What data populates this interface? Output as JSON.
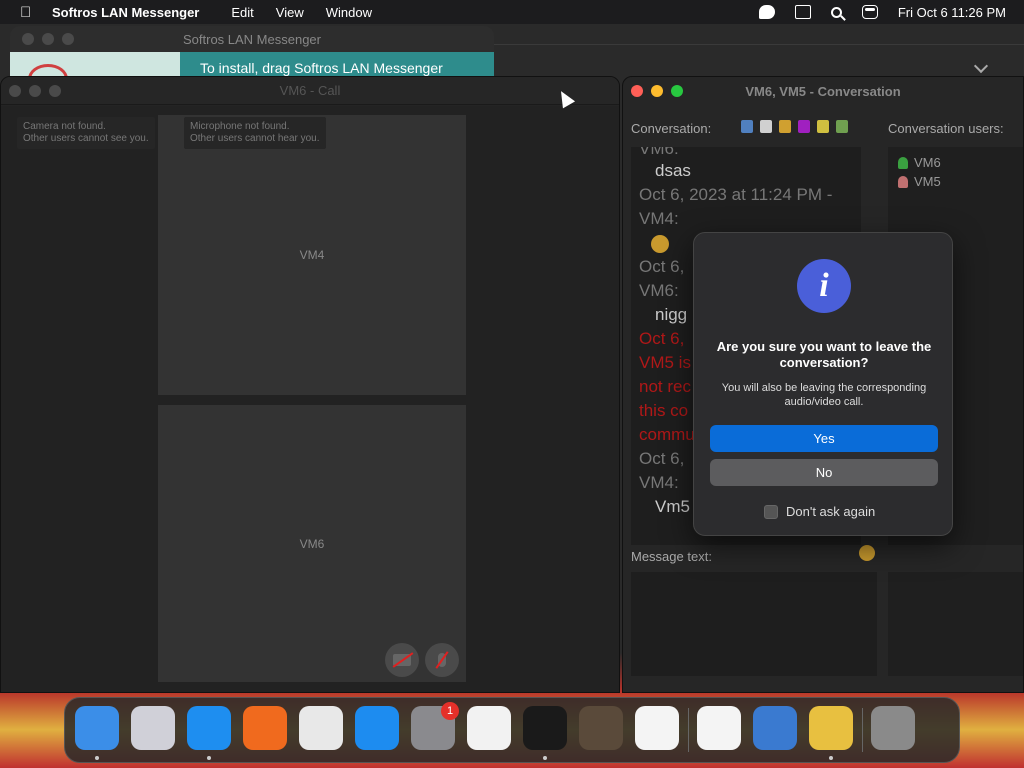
{
  "menubar": {
    "app_name": "Softros LAN Messenger",
    "menus": [
      "Edit",
      "View",
      "Window"
    ],
    "datetime": "Fri Oct 6  11:26 PM"
  },
  "installer": {
    "title": "Softros LAN Messenger",
    "banner": "To install, drag Softros LAN Messenger"
  },
  "call_window": {
    "title": "VM6 - Call",
    "camera_notice_1": "Camera not found.",
    "camera_notice_2": "Other users cannot see you.",
    "mic_notice_1": "Microphone not found.",
    "mic_notice_2": "Other users cannot hear you.",
    "tiles": [
      "VM4",
      "VM6"
    ]
  },
  "conversation_window": {
    "title": "VM6, VM5 - Conversation",
    "conversation_label": "Conversation:",
    "users_label": "Conversation users:",
    "message_label": "Message text:",
    "chat_lines": [
      {
        "text": "VM6:",
        "kind": "meta"
      },
      {
        "text": "dsas",
        "kind": "msg"
      },
      {
        "text": "Oct 6, 2023 at 11:24 PM -",
        "kind": "meta"
      },
      {
        "text": "VM4:",
        "kind": "meta"
      },
      {
        "text": "Oct 6,",
        "kind": "meta"
      },
      {
        "text": "VM6:",
        "kind": "meta"
      },
      {
        "text": "nigg",
        "kind": "msg"
      },
      {
        "text": "Oct 6,",
        "kind": "red"
      },
      {
        "text": "VM5 is",
        "kind": "red"
      },
      {
        "text": "not rec",
        "kind": "red"
      },
      {
        "text": "this co",
        "kind": "red"
      },
      {
        "text": "commu",
        "kind": "red"
      },
      {
        "text": "Oct 6,",
        "kind": "meta"
      },
      {
        "text": "VM4:",
        "kind": "meta"
      },
      {
        "text": "Vm5",
        "kind": "msg"
      }
    ],
    "users": [
      "VM6",
      "VM5"
    ],
    "user_colors": [
      "#3aa040",
      "#c07070"
    ],
    "toolbar_colors": [
      "#5080c0",
      "#d0d0d0",
      "#d0a030",
      "#a020c0",
      "#d0c040",
      "#70a050"
    ]
  },
  "dialog": {
    "title": "Are you sure you want to leave the conversation?",
    "description": "You will also be leaving the corresponding audio/video call.",
    "yes_label": "Yes",
    "no_label": "No",
    "checkbox_label": "Don't ask again",
    "icon": "info-icon"
  },
  "dock": {
    "apps": [
      {
        "name": "finder-icon",
        "color": "#3b8ee8",
        "running": true
      },
      {
        "name": "launchpad-icon",
        "color": "#d0d0d8",
        "running": false
      },
      {
        "name": "safari-icon",
        "color": "#1e8ef0",
        "running": true
      },
      {
        "name": "firefox-icon",
        "color": "#f06a1e",
        "running": false
      },
      {
        "name": "chrome-icon",
        "color": "#e8e8e8",
        "running": false
      },
      {
        "name": "app-store-icon",
        "color": "#1d8cf0",
        "running": false
      },
      {
        "name": "system-settings-icon",
        "color": "#8a8a8e",
        "running": false,
        "badge": "1"
      },
      {
        "name": "textedit-icon",
        "color": "#f2f2f2",
        "running": false
      },
      {
        "name": "terminal-icon",
        "color": "#1a1a1a",
        "running": true
      },
      {
        "name": "garageband-icon",
        "color": "#5a4a3a",
        "running": false
      },
      {
        "name": "vscode-icon",
        "color": "#f4f4f4",
        "running": false
      },
      {
        "name": "visual-studio-icon",
        "color": "#f4f4f4",
        "running": false
      },
      {
        "name": "weather-icon",
        "color": "#3a7ad0",
        "running": false
      },
      {
        "name": "softros-messenger-icon",
        "color": "#e8c040",
        "running": true
      },
      {
        "name": "trash-icon",
        "color": "#8a8a8a",
        "running": false
      }
    ]
  }
}
